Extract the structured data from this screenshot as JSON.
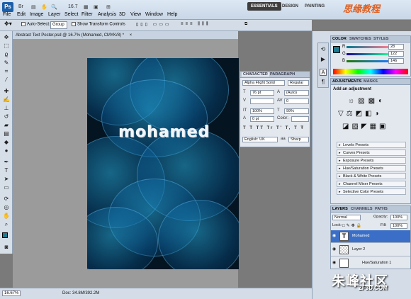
{
  "app": {
    "logo": "Ps",
    "zoom_display": "16.7"
  },
  "workspaces": [
    "ESSENTIALS",
    "DESIGN",
    "PAINTING"
  ],
  "menu": [
    "File",
    "Edit",
    "Image",
    "Layer",
    "Select",
    "Filter",
    "Analysis",
    "3D",
    "View",
    "Window",
    "Help"
  ],
  "options": {
    "auto_select_label": "Auto-Select:",
    "auto_select_value": "Group",
    "show_transform_label": "Show Transform Controls"
  },
  "document": {
    "tab_title": "Abstract Text Poster.psd @ 16.7% (Mohamed, CMYK/8) *",
    "poster_text": "mohamed"
  },
  "status": {
    "zoom": "16.67%",
    "doc_size": "Doc: 34.8M/392.2M"
  },
  "character_panel": {
    "tabs": [
      "CHARACTER",
      "PARAGRAPH"
    ],
    "font_family": "Alpha Flight Solid",
    "font_style": "Regular",
    "font_size": "76 pt",
    "leading": "(Auto)",
    "kerning": "0",
    "vertical_scale": "100%",
    "horizontal_scale": "99%",
    "baseline_shift": "0 pt",
    "color_label": "Color:",
    "language": "English: UK",
    "antialias": "Sharp"
  },
  "color_panel": {
    "tabs": [
      "COLOR",
      "SWATCHES",
      "STYLES"
    ],
    "channels": [
      {
        "label": "R",
        "value": "28"
      },
      {
        "label": "G",
        "value": "122"
      },
      {
        "label": "B",
        "value": "146"
      }
    ],
    "fg_color": "#1c7a92"
  },
  "adjustments_panel": {
    "tabs": [
      "ADJUSTMENTS",
      "MASKS"
    ],
    "heading": "Add an adjustment",
    "presets": [
      "Levels Presets",
      "Curves Presets",
      "Exposure Presets",
      "Hue/Saturation Presets",
      "Black & White Presets",
      "Channel Mixer Presets",
      "Selective Color Presets"
    ]
  },
  "layers_panel": {
    "tabs": [
      "LAYERS",
      "CHANNELS",
      "PATHS"
    ],
    "blend_mode": "Normal",
    "opacity_label": "Opacity:",
    "opacity_value": "100%",
    "lock_label": "Lock:",
    "fill_label": "Fill:",
    "fill_value": "100%",
    "layers": [
      {
        "name": "Mohamed",
        "selected": true
      },
      {
        "name": "Layer 2",
        "selected": false
      },
      {
        "name": "Hue/Saturation 1",
        "selected": false
      }
    ]
  },
  "watermarks": {
    "top": "思缘教程",
    "bottom": "朱峰社区",
    "bottom_url": "ZF3D.COM"
  }
}
